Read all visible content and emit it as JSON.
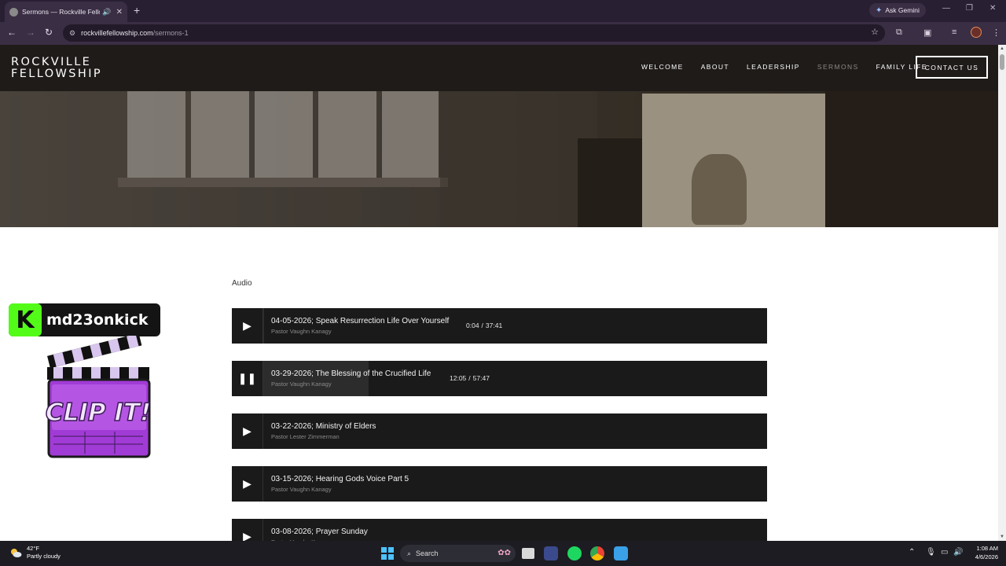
{
  "browser": {
    "tab_title": "Sermons — Rockville Fellow",
    "tab_close": "✕",
    "new_tab": "+",
    "ask_gemini": "Ask Gemini",
    "url_domain": "rockvillefellowship.com",
    "url_path": "/sermons-1",
    "icons": [
      "back-icon",
      "forward-icon",
      "reload-icon",
      "site-settings-icon",
      "bookmark-star-icon",
      "extensions-icon",
      "reading-mode-icon",
      "media-controls-icon",
      "profile-avatar",
      "menu-icon"
    ]
  },
  "site": {
    "logo_line1": "ROCKVILLE",
    "logo_line2": "FELLOWSHIP",
    "nav": [
      {
        "label": "WELCOME"
      },
      {
        "label": "ABOUT"
      },
      {
        "label": "LEADERSHIP"
      },
      {
        "label": "SERMONS",
        "active": true
      },
      {
        "label": "FAMILY LIFE"
      }
    ],
    "contact_label": "CONTACT US",
    "section_label": "Audio"
  },
  "tracks": [
    {
      "title": "04-05-2026; Speak Resurrection Life Over Yourself",
      "speaker": "Pastor Vaughn Kanagy",
      "state": "paused",
      "current": "0:04",
      "sep": "/",
      "duration": "37:41",
      "progress": 0.0018
    },
    {
      "title": "03-29-2026; The Blessing of the Crucified Life",
      "speaker": "Pastor Vaughn Kanagy",
      "state": "playing",
      "current": "12:05",
      "sep": "/",
      "duration": "57:47",
      "progress": 0.209
    },
    {
      "title": "03-22-2026; Ministry of Elders",
      "speaker": "Pastor Lester Zimmerman",
      "state": "paused",
      "current": "",
      "sep": "",
      "duration": "",
      "progress": 0
    },
    {
      "title": "03-15-2026; Hearing Gods Voice Part 5",
      "speaker": "Pastor Vaughn Kanagy",
      "state": "paused",
      "current": "",
      "sep": "",
      "duration": "",
      "progress": 0
    },
    {
      "title": "03-08-2026; Prayer Sunday",
      "speaker": "Pastor Vaughn Kanagy",
      "state": "paused",
      "current": "",
      "sep": "",
      "duration": "",
      "progress": 0
    }
  ],
  "overlay": {
    "kick_letter": "K",
    "kick_name": "md23onkick",
    "clip_text": "CLIP IT!"
  },
  "taskbar": {
    "temp": "42°F",
    "condition": "Partly cloudy",
    "search": "Search",
    "time": "1:08 AM",
    "date": "4/6/2026"
  },
  "colors": {
    "header_bg": "#1e1b19",
    "player_bg": "#1a1a1a",
    "kick_green": "#53fc18",
    "clip_purple": "#a13bd6"
  }
}
